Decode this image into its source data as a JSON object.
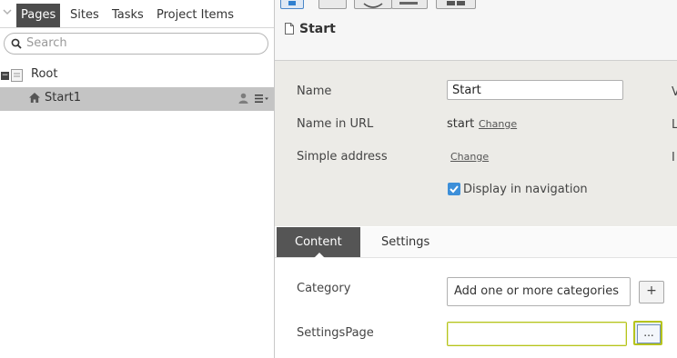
{
  "left_panel": {
    "tabs": [
      "Pages",
      "Sites",
      "Tasks",
      "Project Items"
    ],
    "active_tab": "Pages",
    "search": {
      "placeholder": "Search",
      "value": ""
    },
    "tree": {
      "root_label": "Root",
      "child_label": "Start1"
    }
  },
  "right_panel": {
    "page_title": "Start",
    "properties": {
      "name_label": "Name",
      "name_value": "Start",
      "url_label": "Name in URL",
      "url_value": "start",
      "url_change": "Change",
      "address_label": "Simple address",
      "address_change": "Change",
      "nav_label": "Display in navigation",
      "nav_checked": true,
      "cut_letters": [
        "V",
        "L",
        "I"
      ]
    },
    "content_tabs": [
      "Content",
      "Settings"
    ],
    "active_content_tab": "Content",
    "fields": {
      "category_label": "Category",
      "category_placeholder": "Add one or more categories",
      "add_button": "+",
      "settings_label": "SettingsPage",
      "settings_value": "",
      "browse_button": "..."
    }
  },
  "colors": {
    "active_tab_bg": "#4c4c4c",
    "selected_row_bg": "#c4c4c4",
    "properties_bg": "#ecebe7",
    "checkbox_accent": "#3d8fd9",
    "focus_border": "#b6c41c"
  }
}
